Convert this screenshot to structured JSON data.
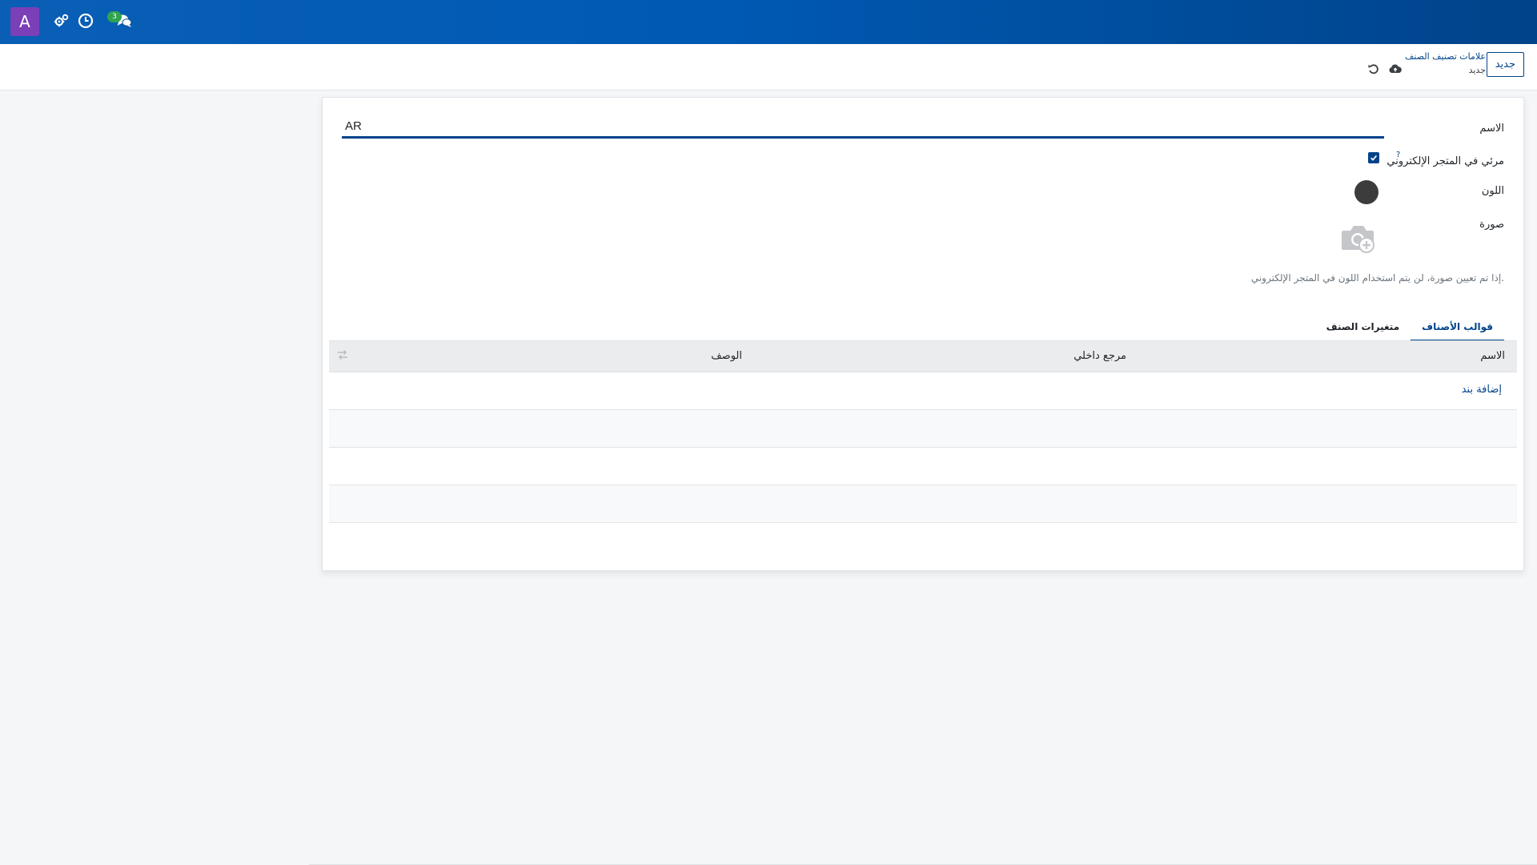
{
  "navbar": {
    "avatar_letter": "A",
    "icons": [
      "settings-gears-icon",
      "clock-icon",
      "chat-icon"
    ],
    "chat_badge": "3",
    "brand_color": "#005ab4"
  },
  "control_panel": {
    "new_button": "جديد",
    "breadcrumb_parent": "علامات تصنيف الصنف",
    "breadcrumb_current": "جديد"
  },
  "form": {
    "name_label": "الاسم",
    "name_value": "AR",
    "ecommerce_label": "مرئي في المتجر الإلكتروني",
    "ecommerce_help": "?",
    "ecommerce_checked": true,
    "color_label": "اللون",
    "color_value": "#3c3c3c",
    "image_label": "صورة",
    "image_hint": "إذا تم تعيين صورة، لن يتم استخدام اللون في المتجر الإلكتروني."
  },
  "tabs": [
    {
      "label": "قوالب الأصناف",
      "active": true
    },
    {
      "label": "متغيرات الصنف",
      "active": false
    }
  ],
  "table": {
    "columns": [
      "الاسم",
      "مرجع داخلي",
      "الوصف"
    ],
    "add_line": "إضافة بند"
  }
}
